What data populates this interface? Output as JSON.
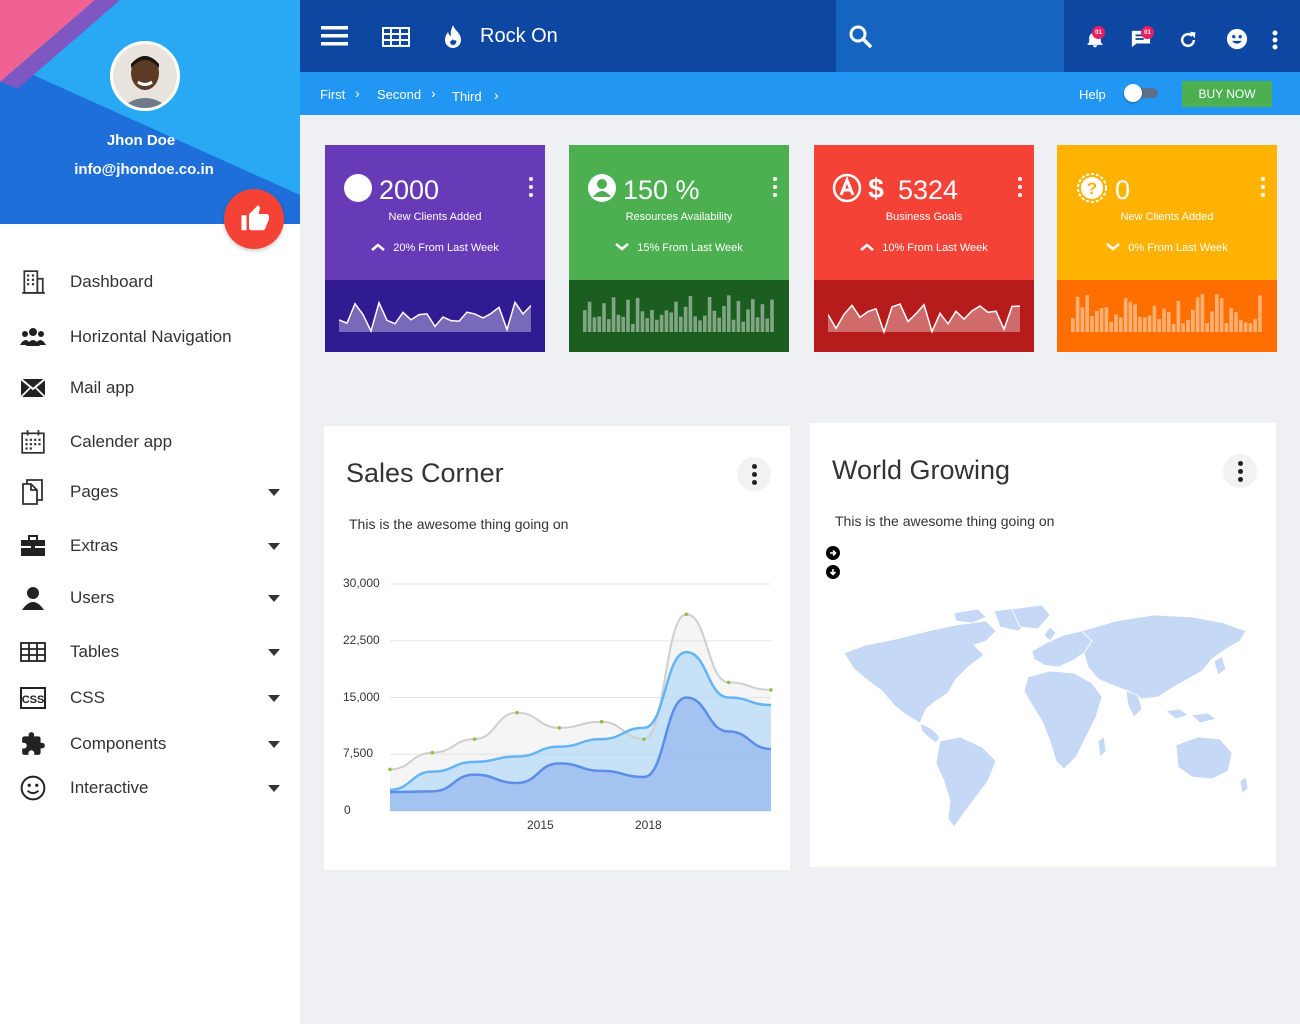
{
  "profile": {
    "name": "Jhon Doe",
    "email": "info@jhondoe.co.in"
  },
  "sidebar": {
    "items": [
      {
        "label": "Dashboard",
        "icon": "building-icon",
        "has_submenu": false
      },
      {
        "label": "Horizontal Navigation",
        "icon": "users-group-icon",
        "has_submenu": false
      },
      {
        "label": "Mail app",
        "icon": "envelope-icon",
        "has_submenu": false
      },
      {
        "label": "Calender app",
        "icon": "calendar-icon",
        "has_submenu": false
      },
      {
        "label": "Pages",
        "icon": "pages-icon",
        "has_submenu": true
      },
      {
        "label": "Extras",
        "icon": "briefcase-icon",
        "has_submenu": true
      },
      {
        "label": "Users",
        "icon": "user-icon",
        "has_submenu": true
      },
      {
        "label": "Tables",
        "icon": "table-icon",
        "has_submenu": true
      },
      {
        "label": "CSS",
        "icon": "css-icon",
        "has_submenu": true
      },
      {
        "label": "Components",
        "icon": "puzzle-icon",
        "has_submenu": true
      },
      {
        "label": "Interactive",
        "icon": "smiley-icon",
        "has_submenu": true
      }
    ]
  },
  "topbar": {
    "title": "Rock On",
    "notification_badge": "01",
    "message_badge": "01"
  },
  "breadcrumb": {
    "items": [
      "First",
      "Second",
      "Third"
    ]
  },
  "header_actions": {
    "help_label": "Help",
    "buy_label": "BUY NOW",
    "toggle_on": false
  },
  "stat_cards": [
    {
      "value": "2000",
      "desc": "New Clients Added",
      "trend": "20% From Last Week",
      "trend_dir": "up",
      "color": "#673ab7",
      "dark": "#311b92",
      "chart": "line"
    },
    {
      "value": "150 %",
      "desc": "Resources Availability",
      "trend": "15% From Last Week",
      "trend_dir": "down",
      "color": "#4caf50",
      "dark": "#1b5e20",
      "chart": "bar"
    },
    {
      "value": "5324",
      "desc": "Business Goals",
      "trend": "10% From Last Week",
      "trend_dir": "up",
      "color": "#f44336",
      "dark": "#b71c1c",
      "chart": "line"
    },
    {
      "value": "0",
      "desc": "New Clients Added",
      "trend": "0% From Last Week",
      "trend_dir": "down",
      "color": "#ffb300",
      "dark": "#ff6f00",
      "chart": "bar"
    }
  ],
  "sales": {
    "title": "Sales Corner",
    "subtitle": "This is the awesome thing going on",
    "chart_data": {
      "type": "area",
      "x_ticks": [
        "2015",
        "2018"
      ],
      "y_ticks": [
        "30,000",
        "22,500",
        "15,000",
        "7,500",
        "0"
      ],
      "ylim": [
        0,
        30000
      ],
      "points": 10,
      "series": [
        {
          "values": [
            5500,
            7700,
            9500,
            13000,
            11000,
            11800,
            9500,
            26000,
            17000,
            16000
          ],
          "color": "#cfcfcf"
        },
        {
          "values": [
            2800,
            5200,
            6500,
            7200,
            8500,
            9500,
            11000,
            21000,
            15000,
            14000
          ],
          "color": "#64b5f6"
        },
        {
          "values": [
            2500,
            2600,
            4800,
            3700,
            6300,
            5300,
            4500,
            15000,
            10500,
            8200
          ],
          "color": "#5c8dea"
        }
      ]
    }
  },
  "world": {
    "title": "World Growing",
    "subtitle": "This is the awesome thing going on"
  }
}
